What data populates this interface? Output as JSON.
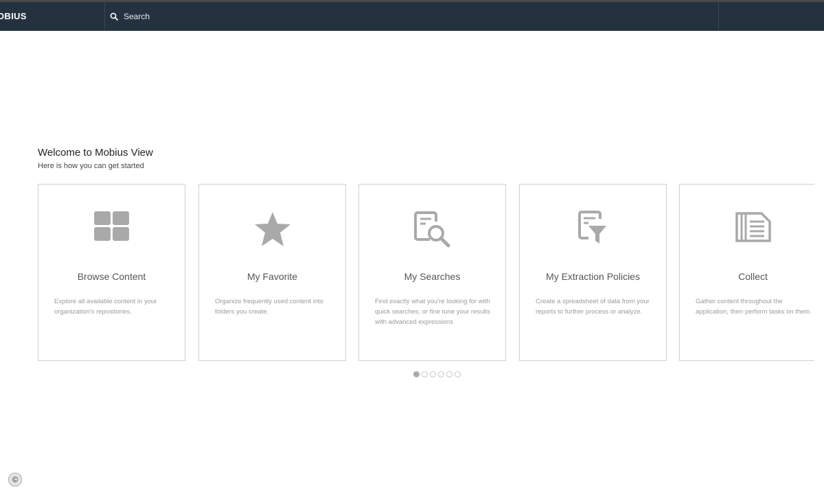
{
  "header": {
    "brand": "OBIUS",
    "search": {
      "placeholder": "Search",
      "value": ""
    }
  },
  "welcome": {
    "title": "Welcome to Mobius View",
    "subtitle": "Here is how you can get started"
  },
  "cards": [
    {
      "icon": "grid-icon",
      "title": "Browse Content",
      "description": "Explore all available content in your organization's repositories."
    },
    {
      "icon": "star-icon",
      "title": "My Favorite",
      "description": "Organize frequently used content into folders you create."
    },
    {
      "icon": "document-search-icon",
      "title": "My Searches",
      "description": "Find exactly what you're looking for with quick searches, or fine tune your results with advanced expressions"
    },
    {
      "icon": "document-filter-icon",
      "title": "My Extraction Policies",
      "description": "Create a spreadsheet of data from your reports to further process or analyze."
    },
    {
      "icon": "document-list-icon",
      "title": "Collect",
      "description": "Gather content throughout the application, then perform tasks on them."
    }
  ],
  "pagination": {
    "total": 6,
    "current": 1
  },
  "footer": {
    "copyright_symbol": "©"
  },
  "colors": {
    "header_bg": "#243240",
    "icon_gray": "#a9a9a9",
    "card_border": "#cfcfcf"
  }
}
